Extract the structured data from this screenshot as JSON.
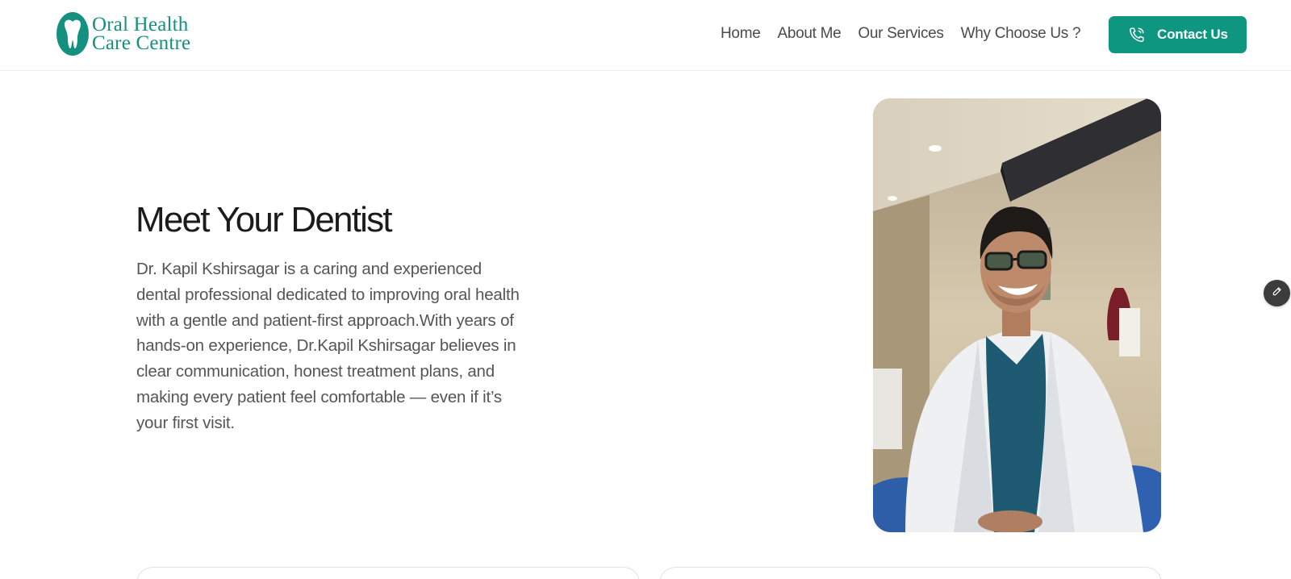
{
  "header": {
    "logo": {
      "line1": "Oral Health",
      "line2": "Care Centre",
      "icon": "tooth-icon"
    },
    "nav": [
      {
        "label": "Home"
      },
      {
        "label": "About Me"
      },
      {
        "label": "Our Services"
      },
      {
        "label": "Why Choose Us ?"
      }
    ],
    "contact_button": {
      "label": "Contact Us",
      "icon": "phone-icon"
    }
  },
  "hero": {
    "title": "Meet Your Dentist",
    "text": "Dr. Kapil Kshirsagar is a caring and experienced dental professional dedicated to improving oral health with a gentle and patient-first approach.With years of hands-on experience, Dr.Kapil Kshirsagar believes in clear communication, honest treatment plans, and making every patient feel comfortable — even if it’s your first visit."
  },
  "floating": {
    "edit_icon": "pencil-icon"
  },
  "colors": {
    "brand": "#0f9680",
    "logo": "#16907e",
    "text": "#555555",
    "heading": "#1b1b1b"
  }
}
